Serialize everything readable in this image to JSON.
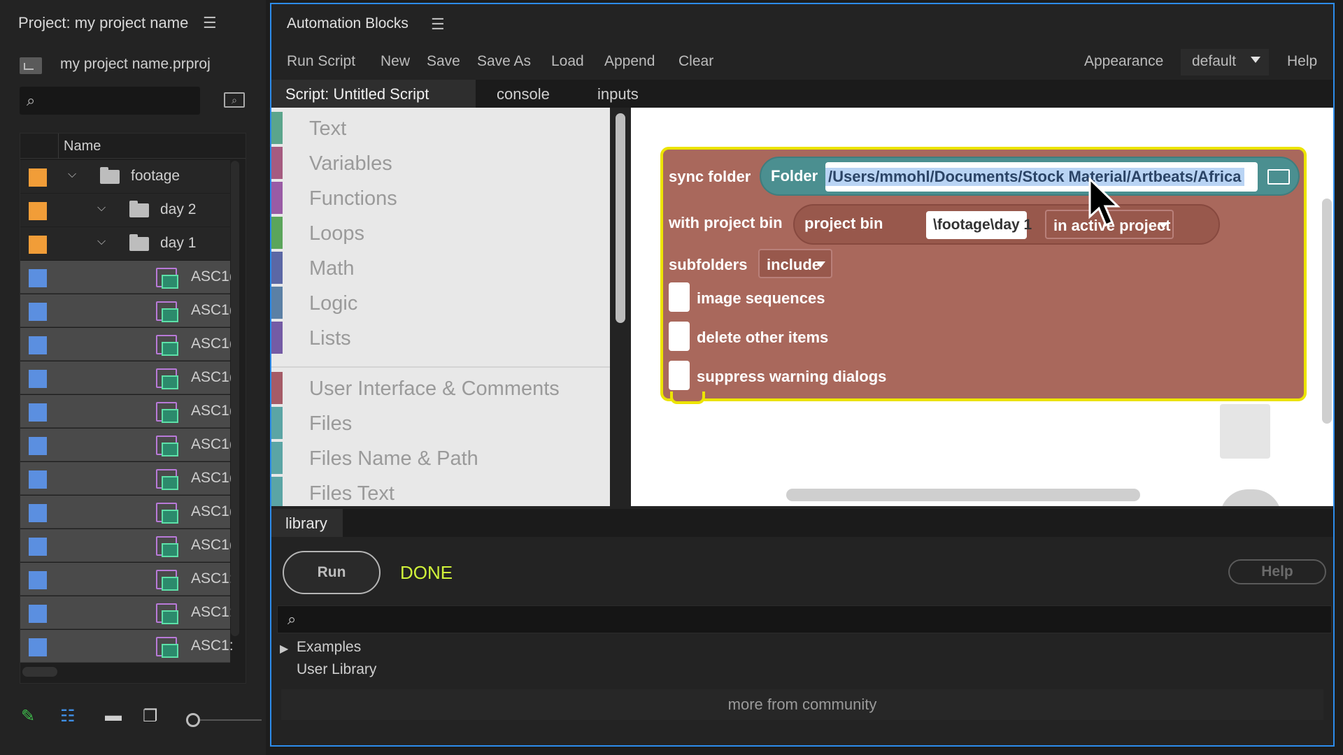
{
  "project_panel": {
    "title": "Project: my project name",
    "file_name": "my project name.prproj",
    "search": {
      "placeholder": ""
    },
    "column_header": "Name",
    "rows": [
      {
        "name": "footage",
        "type": "folder",
        "swatch": "#f19d38"
      },
      {
        "name": "day 2",
        "type": "folder",
        "swatch": "#f19d38"
      },
      {
        "name": "day 1",
        "type": "folder",
        "swatch": "#f19d38"
      },
      {
        "name": "ASC1(",
        "type": "clip",
        "swatch": "#5b8fe0"
      },
      {
        "name": "ASC1(",
        "type": "clip",
        "swatch": "#5b8fe0"
      },
      {
        "name": "ASC1(",
        "type": "clip",
        "swatch": "#5b8fe0"
      },
      {
        "name": "ASC1(",
        "type": "clip",
        "swatch": "#5b8fe0"
      },
      {
        "name": "ASC1(",
        "type": "clip",
        "swatch": "#5b8fe0"
      },
      {
        "name": "ASC1(",
        "type": "clip",
        "swatch": "#5b8fe0"
      },
      {
        "name": "ASC1(",
        "type": "clip",
        "swatch": "#5b8fe0"
      },
      {
        "name": "ASC1(",
        "type": "clip",
        "swatch": "#5b8fe0"
      },
      {
        "name": "ASC1(",
        "type": "clip",
        "swatch": "#5b8fe0"
      },
      {
        "name": "ASC1:",
        "type": "clip",
        "swatch": "#5b8fe0"
      },
      {
        "name": "ASC1:",
        "type": "clip",
        "swatch": "#5b8fe0"
      },
      {
        "name": "ASC1:",
        "type": "clip",
        "swatch": "#5b8fe0"
      }
    ],
    "bottom_icons": [
      "pencil-icon",
      "list-view-icon",
      "icon-view-icon",
      "freeform-view-icon",
      "zoom-slider"
    ]
  },
  "automation_blocks": {
    "title": "Automation Blocks",
    "menu": [
      "Run Script",
      "New",
      "Save",
      "Save As",
      "Load",
      "Append",
      "Clear"
    ],
    "appearance_label": "Appearance",
    "theme_value": "default",
    "help_label": "Help",
    "tabs": [
      "Script: Untitled Script",
      "console",
      "inputs"
    ],
    "toolbox": [
      {
        "label": "Text",
        "color": "#5ba58c"
      },
      {
        "label": "Variables",
        "color": "#a55b80"
      },
      {
        "label": "Functions",
        "color": "#995ba5"
      },
      {
        "label": "Loops",
        "color": "#5ba55b"
      },
      {
        "label": "Math",
        "color": "#5b67a5"
      },
      {
        "label": "Logic",
        "color": "#5b80a5"
      },
      {
        "label": "Lists",
        "color": "#745ba5"
      },
      {
        "label": "User Interface & Comments",
        "color": "#a55b67"
      },
      {
        "label": "Files",
        "color": "#5ba5a5"
      },
      {
        "label": "Files Name & Path",
        "color": "#5ba5a5"
      },
      {
        "label": "Files Text",
        "color": "#5ba5a5"
      }
    ],
    "block": {
      "label_sync": "sync folder",
      "label_folder": "Folder",
      "folder_path": "/Users/mmohl/Documents/Stock Material/Artbeats/Africa",
      "label_with_bin": "with project bin",
      "label_project_bin": "project bin",
      "bin_path": "\\footage\\day 1",
      "bin_scope": "in active project",
      "label_subfolders": "subfolders",
      "subfolders_value": "include",
      "options": [
        "image sequences",
        "delete other items",
        "suppress warning dialogs"
      ]
    },
    "library": {
      "tab": "library",
      "run_label": "Run",
      "status": "DONE",
      "help_label": "Help",
      "search_placeholder": "",
      "tree": [
        "Examples",
        "User Library"
      ],
      "community": "more from community"
    }
  }
}
